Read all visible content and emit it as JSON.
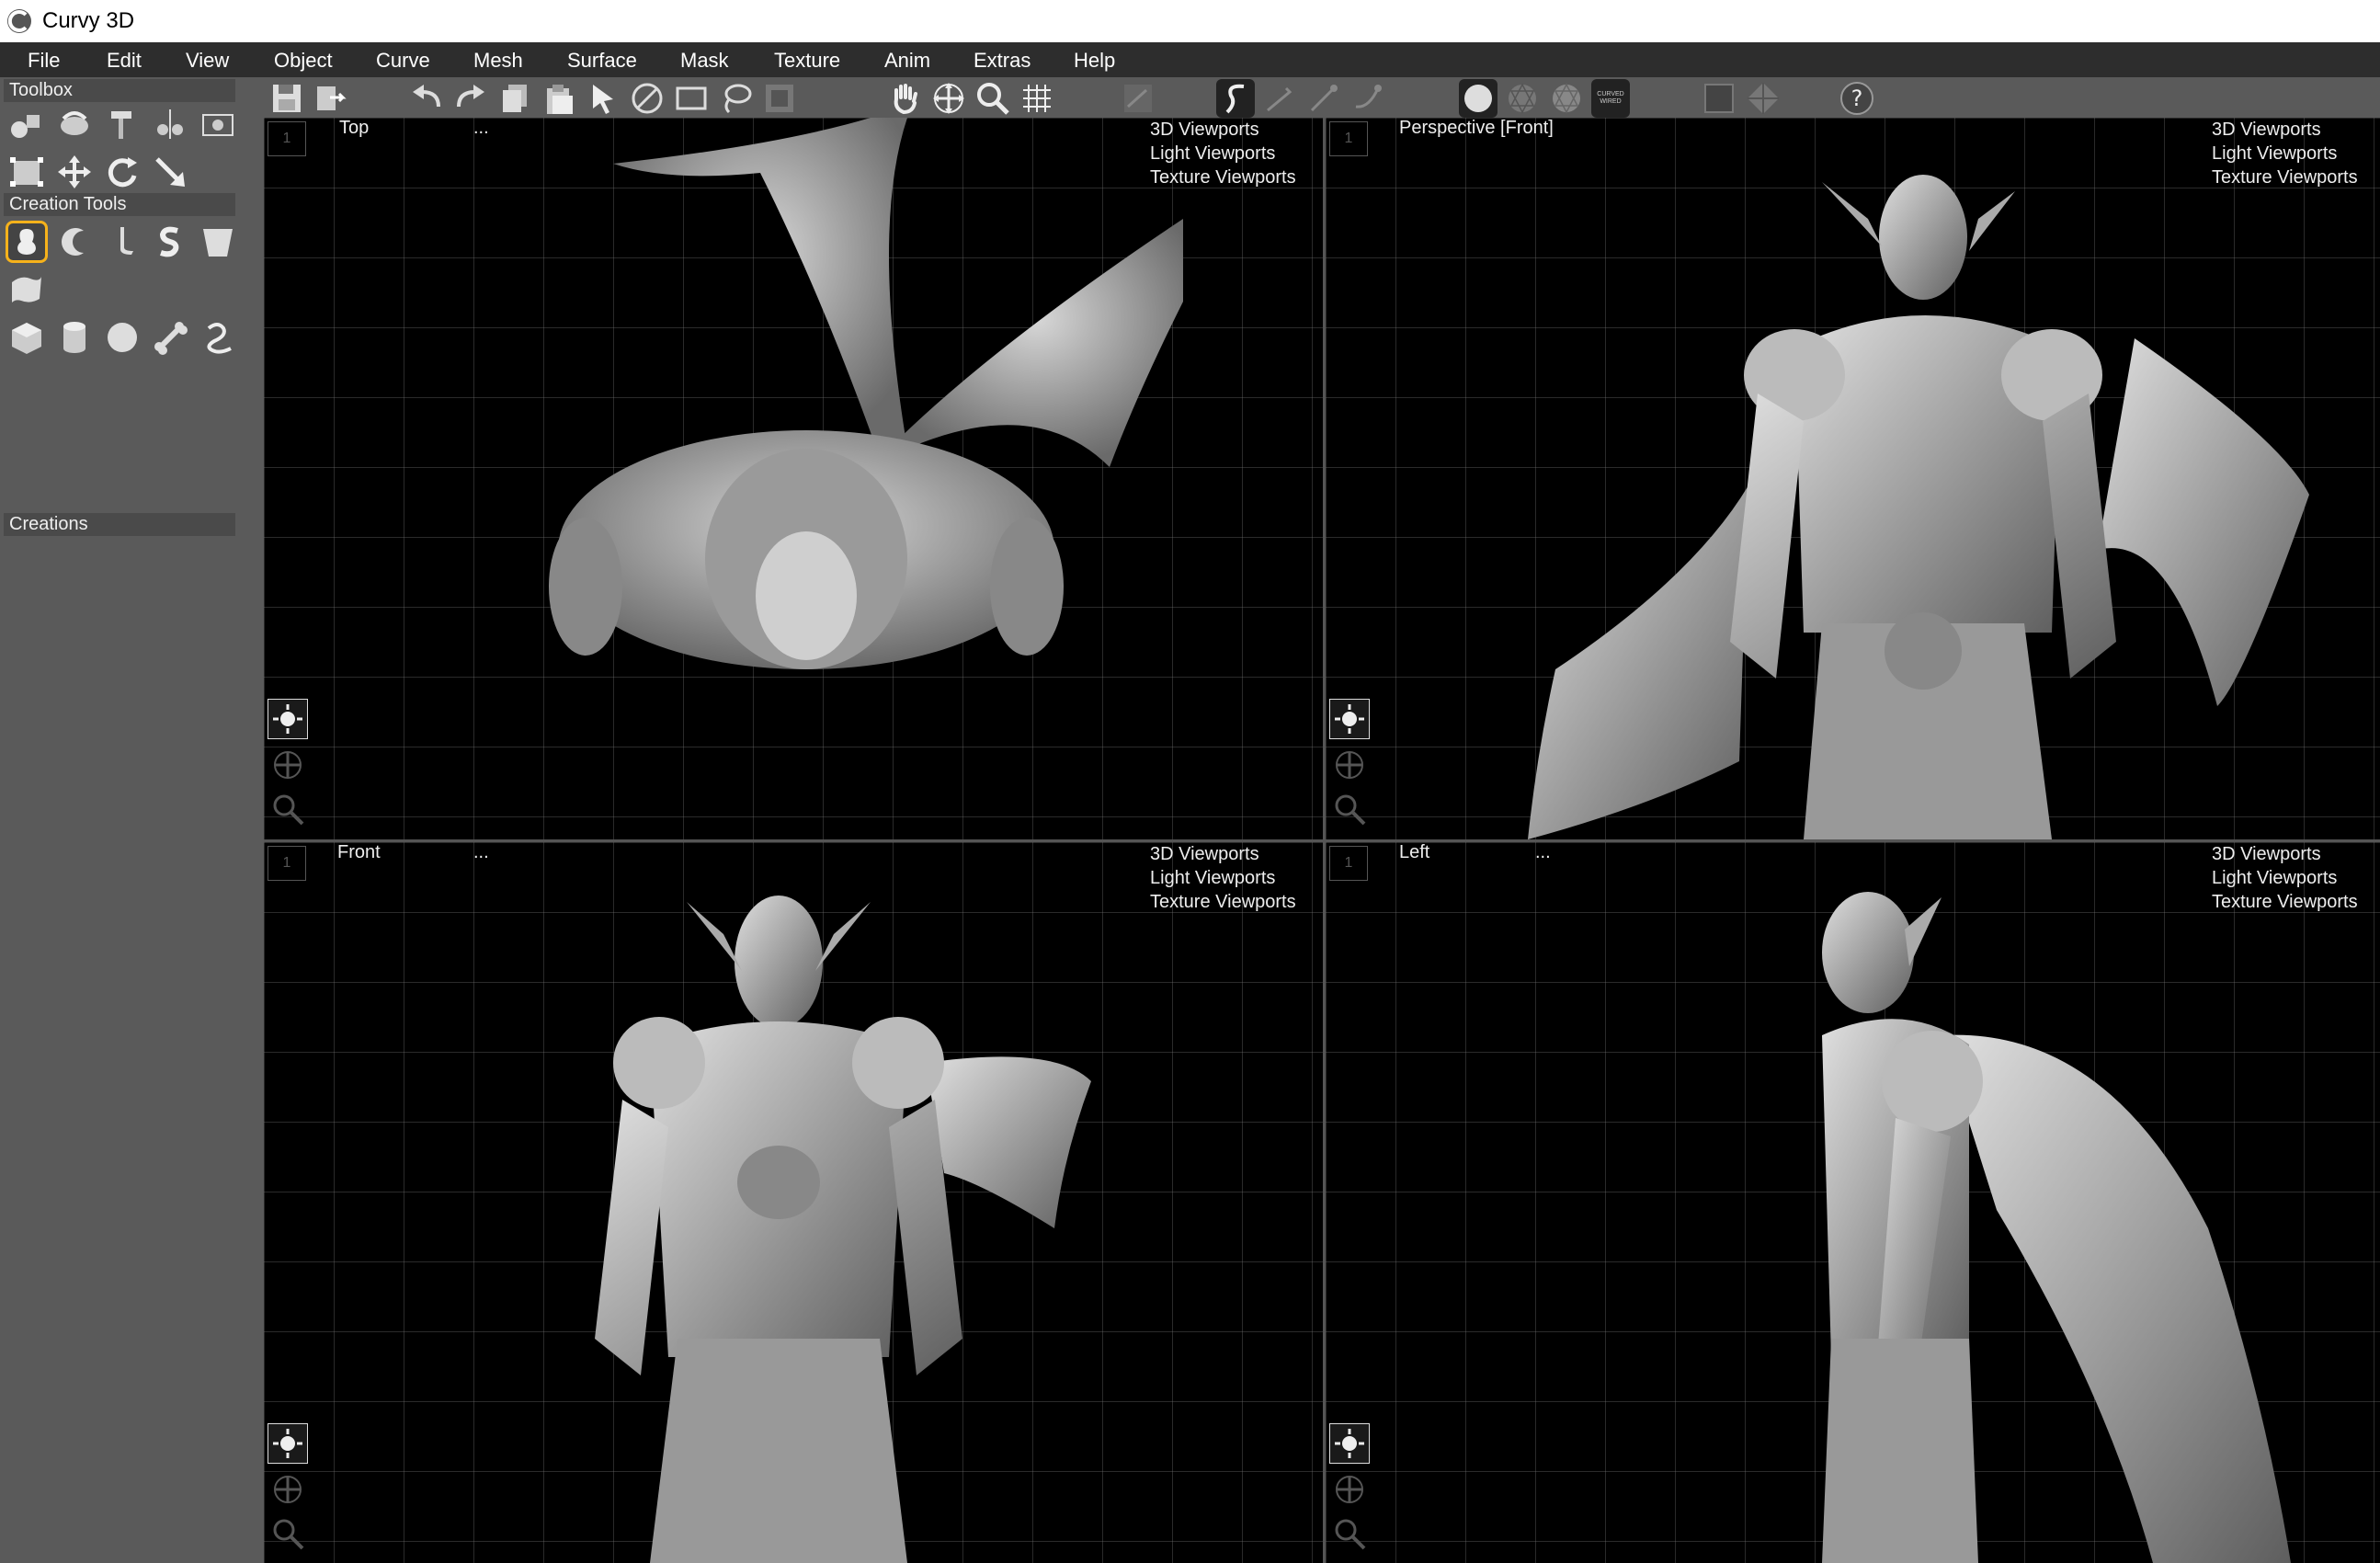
{
  "app": {
    "title": "Curvy 3D",
    "logo_icon": "curvy-logo-icon"
  },
  "menu": [
    "File",
    "Edit",
    "View",
    "Object",
    "Curve",
    "Mesh",
    "Surface",
    "Mask",
    "Texture",
    "Anim",
    "Extras",
    "Help"
  ],
  "left_panel": {
    "toolbox_label": "Toolbox",
    "creation_tools_label": "Creation Tools",
    "creations_label": "Creations"
  },
  "toolbar": {
    "shading_badge_line1": "CURVED",
    "shading_badge_line2": "WIRED",
    "help_glyph": "?"
  },
  "viewports": [
    {
      "name": "Top",
      "extra": "...",
      "menu": [
        "3D Viewports",
        "Light Viewports",
        "Texture Viewports"
      ],
      "index": "1"
    },
    {
      "name": "Perspective [Front]",
      "extra": "",
      "menu": [
        "3D Viewports",
        "Light Viewports",
        "Texture Viewports"
      ],
      "index": "1"
    },
    {
      "name": "Front",
      "extra": "...",
      "menu": [
        "3D Viewports",
        "Light Viewports",
        "Texture Viewports"
      ],
      "index": "1"
    },
    {
      "name": "Left",
      "extra": "...",
      "menu": [
        "3D Viewports",
        "Light Viewports",
        "Texture Viewports"
      ],
      "index": "1"
    }
  ],
  "colors": {
    "accent": "#f6b21b",
    "panel": "#5a5a5a",
    "viewport_bg": "#000000",
    "menubar": "#2d2d2d"
  }
}
